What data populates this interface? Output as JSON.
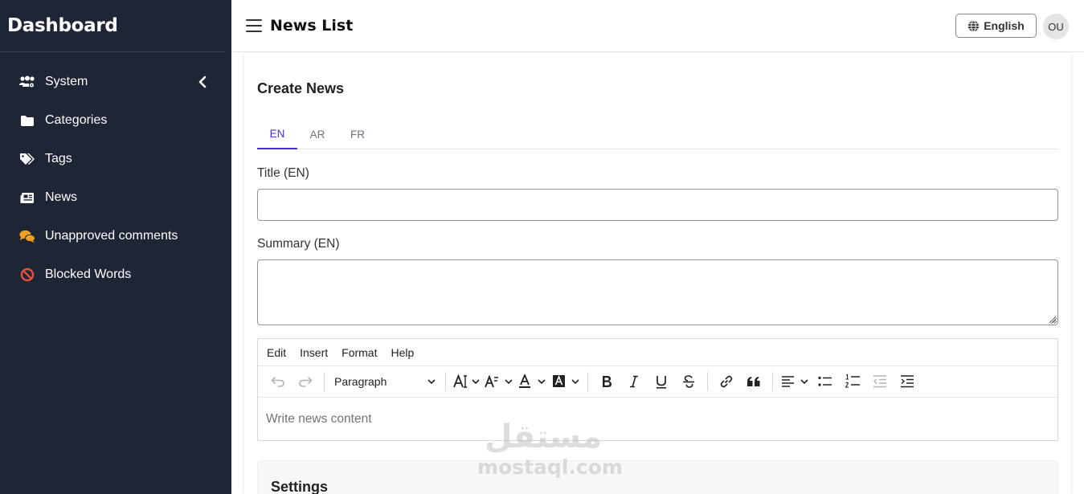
{
  "sidebar": {
    "brand": "Dashboard",
    "items": [
      {
        "label": "System",
        "icon": "users-cog-icon",
        "color": "#ffffff"
      },
      {
        "label": "Categories",
        "icon": "folder-icon",
        "color": "#ffffff"
      },
      {
        "label": "Tags",
        "icon": "tags-icon",
        "color": "#ffffff"
      },
      {
        "label": "News",
        "icon": "newspaper-icon",
        "color": "#ffffff"
      },
      {
        "label": "Unapproved comments",
        "icon": "comments-icon",
        "color": "#f0a020"
      },
      {
        "label": "Blocked Words",
        "icon": "ban-icon",
        "color": "#e5533d"
      }
    ]
  },
  "header": {
    "title": "News List",
    "language": "English",
    "avatar_initials": "OU"
  },
  "form": {
    "title": "Create News",
    "tabs": [
      {
        "label": "EN",
        "active": true
      },
      {
        "label": "AR",
        "active": false
      },
      {
        "label": "FR",
        "active": false
      }
    ],
    "title_label": "Title (EN)",
    "title_value": "",
    "summary_label": "Summary (EN)",
    "summary_value": "",
    "editor": {
      "menus": [
        "Edit",
        "Insert",
        "Format",
        "Help"
      ],
      "block_format": "Paragraph",
      "placeholder": "Write news content"
    },
    "settings_title": "Settings"
  },
  "watermark": {
    "arabic": "مستقل",
    "latin": "mostaql.com"
  },
  "colors": {
    "sidebar_bg": "#1e2535",
    "accent": "#4b2fd1"
  }
}
